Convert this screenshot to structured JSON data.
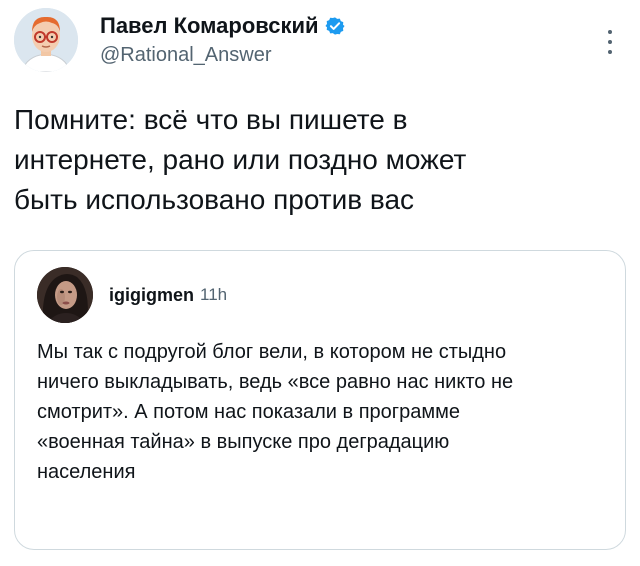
{
  "author": {
    "display_name": "Павел Комаровский",
    "handle": "@Rational_Answer",
    "verified": true,
    "avatar_icon": "cartoon-man-glasses-avatar"
  },
  "tweet": {
    "text": "Помните: всё что вы пишете в\nинтернете, рано или поздно может\nбыть использовано против вас"
  },
  "quote": {
    "username": "igigigmen",
    "time": "11h",
    "text": "Мы так с подругой блог вели, в котором не стыдно\nничего выкладывать, ведь «все равно нас никто не\nсмотрит». А потом нас показали в программе\n«военная тайна» в выпуске про деградацию\nнаселения",
    "avatar_icon": "woman-photo-avatar"
  },
  "colors": {
    "verified": "#1d9bf0",
    "text": "#0f1419",
    "secondary": "#536471",
    "border": "#cfd9de"
  }
}
